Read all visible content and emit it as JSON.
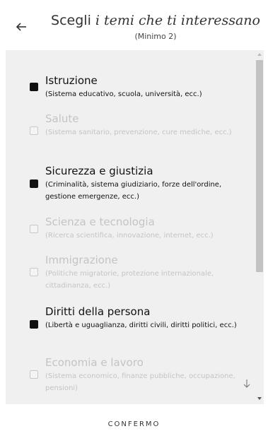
{
  "header": {
    "title_plain": "Scegli ",
    "title_italic": "i temi che ti interessano",
    "subtitle": "(Minimo 2)"
  },
  "topics": [
    {
      "name": "Istruzione",
      "desc": "(Sistema educativo, scuola, università, ecc.)",
      "selected": true
    },
    {
      "name": "Salute",
      "desc": "(Sistema sanitario, prevenzione, cure mediche, ecc.)",
      "selected": false
    },
    {
      "name": "Sicurezza e giustizia",
      "desc": "(Criminalità, sistema giudiziario, forze dell'ordine, gestione emergenze, ecc.)",
      "selected": true
    },
    {
      "name": "Scienza e tecnologia",
      "desc": "(Ricerca scientifica, innovazione, internet, ecc.)",
      "selected": false
    },
    {
      "name": "Immigrazione",
      "desc": "(Politiche migratorie, protezione internazionale, cittadinanza, ecc.)",
      "selected": false
    },
    {
      "name": "Diritti della persona",
      "desc": "(Libertà e uguaglianza, diritti civili, diritti politici, ecc.)",
      "selected": true
    },
    {
      "name": "Economia e lavoro",
      "desc": "(Sistema economico, finanze pubbliche, occupazione, pensioni)",
      "selected": false
    }
  ],
  "footer": {
    "confirm_label": "CONFERMO"
  },
  "icons": {
    "back": "arrow-left-icon",
    "scroll_more": "arrow-down-icon",
    "checkbox_on": "checkbox-checked-icon",
    "checkbox_off": "checkbox-unchecked-icon"
  },
  "colors": {
    "selected_text": "#111111",
    "unselected_text": "#c4c4c4",
    "panel_bg": "#f0f0f0"
  }
}
